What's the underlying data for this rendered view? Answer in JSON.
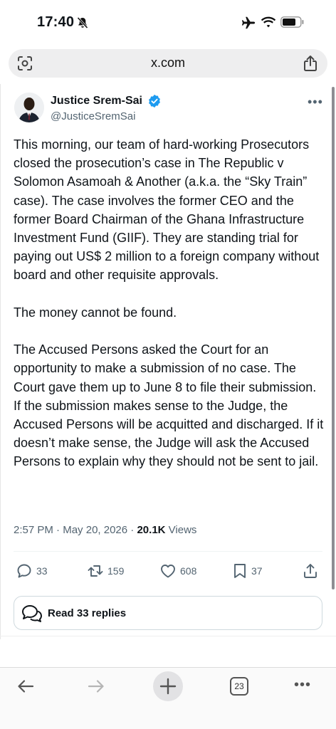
{
  "status_bar": {
    "time": "17:40"
  },
  "browser": {
    "url": "x.com",
    "tab_count": "23"
  },
  "tweet": {
    "author_name": "Justice Srem-Sai",
    "author_handle": "@JusticeSremSai",
    "paragraphs": [
      "This morning, our team of hard-working Prosecutors closed the prosecution’s case in The Republic v Solomon Asamoah & Another (a.k.a. the “Sky Train” case). The case involves the former CEO and the former Board Chairman of the Ghana Infrastructure Investment Fund (GIIF). They are standing trial for paying out US$ 2 million to a foreign company without board and other requisite approvals.",
      "The money cannot be found.",
      "The Accused Persons asked the Court for an opportunity to make a submission of no case. The Court gave them up to June 8 to file their submission. If the submission makes sense to the Judge, the Accused Persons will be acquitted and discharged. If it doesn’t make sense, the Judge will ask the Accused Persons to explain why they should not be sent to jail."
    ],
    "time": "2:57 PM",
    "date": "May 20, 2026",
    "views_count": "20.1K",
    "views_label": "Views",
    "replies": "33",
    "reposts": "159",
    "likes": "608",
    "bookmarks": "37",
    "read_replies_label": "Read 33 replies"
  },
  "colors": {
    "verified": "#1d9bf0",
    "text": "#0f1419",
    "secondary": "#536471"
  },
  "icons": [
    "bell-off-icon",
    "airplane-icon",
    "wifi-icon",
    "battery-icon",
    "camera-scan-icon",
    "share-icon",
    "verified-badge-icon",
    "more-icon",
    "reply-icon",
    "repost-icon",
    "like-icon",
    "bookmark-icon",
    "chat-bubbles-icon",
    "back-arrow-icon",
    "forward-arrow-icon",
    "plus-icon",
    "tabs-icon"
  ]
}
